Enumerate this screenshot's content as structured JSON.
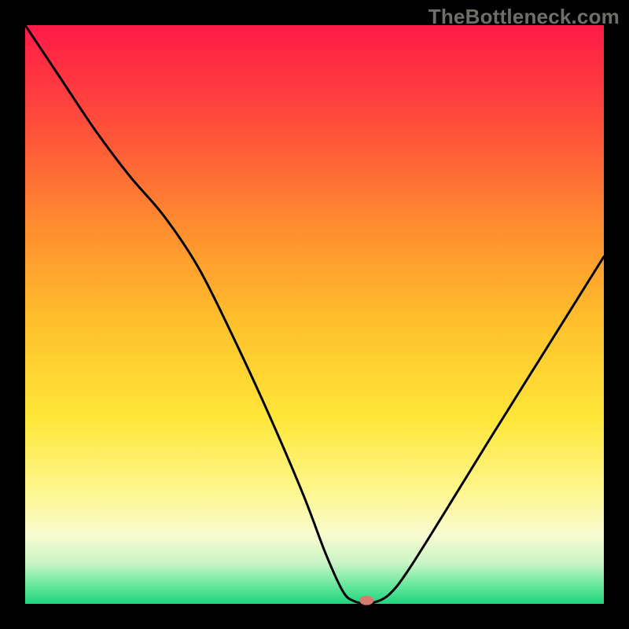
{
  "watermark": "TheBottleneck.com",
  "chart_data": {
    "type": "line",
    "title": "",
    "xlabel": "",
    "ylabel": "",
    "xlim": [
      0,
      100
    ],
    "ylim": [
      0,
      100
    ],
    "background": {
      "type": "vertical-gradient",
      "description": "Red at top through orange, yellow, near-white, to green at bottom",
      "stops": [
        {
          "offset": 0.0,
          "color": "#ff1a49"
        },
        {
          "offset": 0.16,
          "color": "#ff4a3b"
        },
        {
          "offset": 0.34,
          "color": "#ff8a2f"
        },
        {
          "offset": 0.52,
          "color": "#ffc22c"
        },
        {
          "offset": 0.68,
          "color": "#ffe638"
        },
        {
          "offset": 0.8,
          "color": "#fff68a"
        },
        {
          "offset": 0.88,
          "color": "#f8fbcf"
        },
        {
          "offset": 0.93,
          "color": "#c9f5c6"
        },
        {
          "offset": 0.965,
          "color": "#6fe9a0"
        },
        {
          "offset": 1.0,
          "color": "#1fd47e"
        }
      ]
    },
    "border": {
      "color": "#000000",
      "width": 32
    },
    "series": [
      {
        "name": "bottleneck-curve",
        "color": "#000000",
        "stroke_width": 3,
        "x": [
          0.0,
          6.0,
          12.0,
          18.0,
          24.0,
          30.0,
          36.0,
          42.0,
          48.0,
          52.0,
          55.0,
          57.0,
          58.5,
          60.5,
          63.0,
          66.0,
          72.0,
          80.0,
          90.0,
          100.0
        ],
        "y": [
          100.0,
          91.0,
          82.0,
          74.0,
          67.0,
          58.0,
          46.0,
          33.0,
          19.0,
          8.5,
          2.0,
          0.4,
          0.2,
          0.3,
          1.7,
          5.5,
          15.0,
          28.0,
          44.0,
          60.0
        ]
      }
    ],
    "marker": {
      "name": "optimal-point",
      "x": 59.0,
      "y": 0.6,
      "color": "#d87a6f",
      "rx": 9,
      "ry": 6
    }
  }
}
